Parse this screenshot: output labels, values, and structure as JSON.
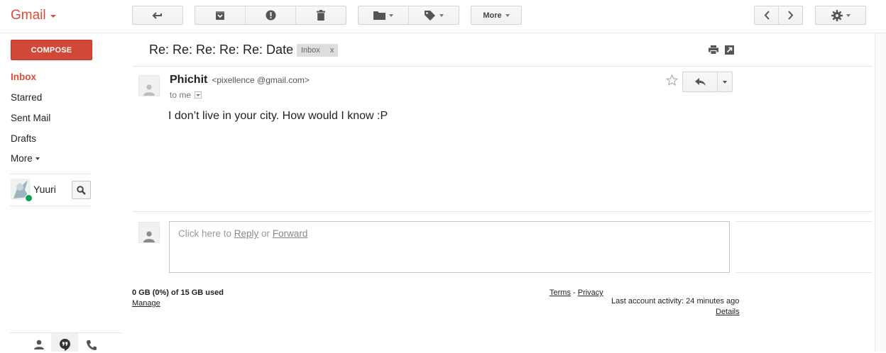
{
  "app": {
    "logo_text": "Gmail"
  },
  "toolbar": {
    "back_icon": "back-arrow-icon",
    "archive_icon": "archive-icon",
    "spam_icon": "report-spam-icon",
    "delete_icon": "trash-icon",
    "move_icon": "folder-icon",
    "labels_icon": "label-tag-icon",
    "more_label": "More",
    "prev_icon": "chevron-left-icon",
    "next_icon": "chevron-right-icon",
    "settings_icon": "gear-icon"
  },
  "sidebar": {
    "compose_label": "COMPOSE",
    "items": [
      {
        "label": "Inbox",
        "active": true
      },
      {
        "label": "Starred"
      },
      {
        "label": "Sent Mail"
      },
      {
        "label": "Drafts"
      },
      {
        "label": "More"
      }
    ],
    "user": {
      "name": "Yuuri",
      "status_color": "#0f9d58"
    }
  },
  "thread": {
    "subject": "Re: Re: Re: Re: Re: Date",
    "label": "Inbox",
    "label_remove": "x",
    "message": {
      "sender_name": "Phichit",
      "sender_email": "<pixellence @gmail.com>",
      "to": "to me",
      "body": "I don’t live in your city. How would I know :P"
    },
    "reply_box": {
      "prefix": "Click here to ",
      "reply": "Reply",
      "or": " or ",
      "forward": "Forward"
    }
  },
  "footer": {
    "storage": "0 GB (0%) of 15 GB used",
    "manage": "Manage",
    "terms": "Terms",
    "dash": " - ",
    "privacy": "Privacy",
    "activity": "Last account activity: 24 minutes ago",
    "details": "Details"
  },
  "colors": {
    "accent": "#dd4b39",
    "compose_bg": "#d14836"
  }
}
